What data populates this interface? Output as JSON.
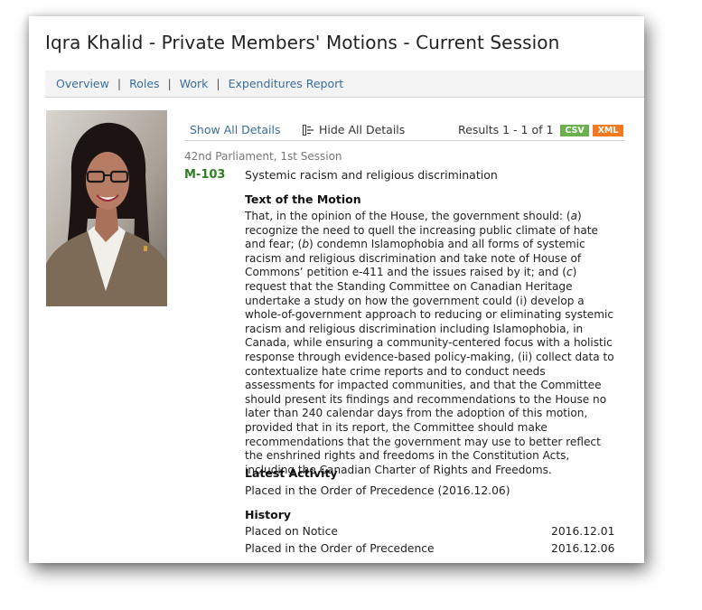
{
  "page": {
    "title": "Iqra Khalid - Private Members' Motions - Current Session"
  },
  "nav": {
    "items": [
      {
        "label": "Overview"
      },
      {
        "label": "Roles"
      },
      {
        "label": "Work"
      },
      {
        "label": "Expenditures Report"
      }
    ],
    "separator": "|"
  },
  "toolbar": {
    "show_all": "Show All Details",
    "hide_all": "Hide All Details",
    "results": "Results 1 - 1 of 1",
    "csv": "CSV",
    "xml": "XML"
  },
  "motion": {
    "parliament": "42nd Parliament, 1st Session",
    "id": "M-103",
    "title": "Systemic racism and religious discrimination",
    "text_heading": "Text of the Motion",
    "text_segments": [
      {
        "t": "That, in the opinion of the House, the government should: ("
      },
      {
        "t": "a",
        "i": true
      },
      {
        "t": ") recognize the need to quell the increasing public climate of hate and fear; ("
      },
      {
        "t": "b",
        "i": true
      },
      {
        "t": ") condemn Islamophobia and all forms of systemic racism and religious discrimination and take note of House of Commons’ petition e-411 and the issues raised by it; and ("
      },
      {
        "t": "c",
        "i": true
      },
      {
        "t": ") request that the Standing Committee on Canadian Heritage undertake a study on how the government could (i) develop a whole-of-government approach to reducing or eliminating systemic racism and religious discrimination including Islamophobia, in Canada, while ensuring a community-centered focus with a holistic response through evidence-based policy-making, (ii) collect data to contextualize hate crime reports and to conduct needs assessments for impacted communities, and that the Committee should present its findings and recommendations to the House no later than 240 calendar days from the adoption of this motion, provided that in its report, the Committee should make recommendations that the government may use to better reflect the enshrined rights and freedoms in the Constitution Acts, including the Canadian Charter of Rights and Freedoms."
      }
    ],
    "latest_heading": "Latest Activity",
    "latest_activity": "Placed in the Order of Precedence (2016.12.06)",
    "history_heading": "History",
    "history": [
      {
        "event": "Placed on Notice",
        "date": "2016.12.01"
      },
      {
        "event": "Placed in the Order of Precedence",
        "date": "2016.12.06"
      }
    ]
  }
}
